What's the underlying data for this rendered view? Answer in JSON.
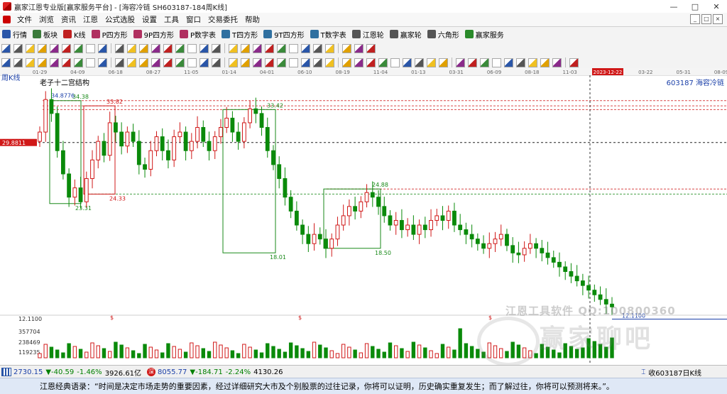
{
  "window": {
    "title": "赢家江恩专业版[赢家服务平台] - [海容冷链 SH603187-184周K线]",
    "minimize": "—",
    "maximize": "□",
    "close": "✕"
  },
  "menu": [
    "文件",
    "浏览",
    "资讯",
    "江恩",
    "公式选股",
    "设置",
    "工具",
    "窗口",
    "交易委托",
    "帮助"
  ],
  "mdi_controls": [
    "_",
    "□",
    "×"
  ],
  "toolbar1": [
    {
      "label": "行情",
      "icon": "grid-icon",
      "color": "#2a56a8"
    },
    {
      "label": "板块",
      "icon": "blocks-icon",
      "color": "#3a7a3a"
    },
    {
      "label": "K线",
      "icon": "candle-icon",
      "color": "#c02020"
    },
    {
      "label": "P四方形",
      "icon": "p-square-icon",
      "color": "#b03060"
    },
    {
      "label": "9P四方形",
      "icon": "9p-square-icon",
      "color": "#b03060"
    },
    {
      "label": "P数字表",
      "icon": "p-table-icon",
      "color": "#b03060"
    },
    {
      "label": "T四方形",
      "icon": "t-square-icon",
      "color": "#3070a0"
    },
    {
      "label": "9T四方形",
      "icon": "9t-square-icon",
      "color": "#3070a0"
    },
    {
      "label": "T数字表",
      "icon": "t-table-icon",
      "color": "#3070a0"
    },
    {
      "label": "江恩轮",
      "icon": "gann-wheel-icon",
      "color": "#555555"
    },
    {
      "label": "赢家轮",
      "icon": "winner-wheel-icon",
      "color": "#555555"
    },
    {
      "label": "六角形",
      "icon": "hexagon-icon",
      "color": "#555555"
    },
    {
      "label": "赢家服务",
      "icon": "dollar-icon",
      "color": "#2a8a2a"
    }
  ],
  "chart_labels": {
    "period": "周K线",
    "stock": "603187 海容冷链",
    "structure": "老子十二宫结构",
    "price_marker": "29.8811",
    "volume_scale": [
      "12.1100",
      "357704",
      "238469",
      "119235"
    ]
  },
  "watermark": {
    "tools": "江恩工具软件 QQ:100800360",
    "brand": "赢家聊吧"
  },
  "status": {
    "sh_index": "2730.15",
    "sh_change": "▼-40.59",
    "sh_pct": "-1.46%",
    "sh_amount": "3926.61亿",
    "sz_index": "8055.77",
    "sz_change": "▼-184.71",
    "sz_pct": "-2.24%",
    "sz_amount": "4130.26",
    "right_text": "收603187日K线"
  },
  "quote": "江恩经典语录：“时间是决定市场走势的重要因素，经过详细研究大市及个别股票的过往记录，你将可以证明，历史确实重复发生；而了解过往，你将可以预测将来。”。",
  "colors": {
    "up": "#d01818",
    "down": "#0a8a0a",
    "box_red": "#d01818",
    "box_green": "#1a8a1a",
    "guide_red": "#d01818",
    "guide_green": "#1a8a1a"
  },
  "chart_data": {
    "type": "candlestick",
    "title": "海容冷链 SH603187 周K线",
    "date_ticks": [
      "01-29",
      "04-09",
      "06-18",
      "08-27",
      "11-05",
      "01-14",
      "04-01",
      "06-10",
      "08-19",
      "11-04",
      "01-13",
      "03-31",
      "06-09",
      "08-18",
      "11-03",
      "2023-12-22",
      "03-22",
      "05-31",
      "08-09"
    ],
    "price_levels": [
      34.8776,
      34.38,
      33.82,
      33.42,
      29.8811,
      24.88,
      24.33,
      23.31,
      18.5,
      18.01,
      12.11
    ],
    "level_labels": [
      "34.8776",
      "34.38",
      "33.82",
      "33.42",
      "24.88",
      "24.33",
      "23.31",
      "18.50",
      "18.01",
      "12.1100"
    ],
    "ylim": [
      11.0,
      36.5
    ],
    "boxes": [
      {
        "label_high": "34.38",
        "label_low": "23.31",
        "high": 34.38,
        "low": 23.31,
        "color": "green"
      },
      {
        "label_high": "33.82",
        "label_low": "24.33",
        "high": 33.82,
        "low": 24.33,
        "color": "red"
      },
      {
        "label_high": "33.42",
        "label_low": "18.01",
        "high": 33.42,
        "low": 18.01,
        "color": "green"
      },
      {
        "label_high": "24.88",
        "label_low": "18.50",
        "high": 24.88,
        "low": 18.5,
        "color": "green"
      }
    ],
    "closes": [
      31,
      34.5,
      33,
      29,
      26.5,
      24,
      25,
      23.5,
      26,
      28,
      30,
      28.5,
      32,
      31,
      29.5,
      31,
      30,
      27.5,
      27,
      29,
      30.5,
      29,
      28,
      30.5,
      31,
      29,
      30,
      31.5,
      30,
      29,
      30.5,
      31.5,
      32.5,
      31,
      30,
      32,
      33.5,
      33,
      31.5,
      29,
      27.5,
      26,
      24,
      22.5,
      21,
      20,
      19,
      20,
      19.5,
      18.5,
      19.5,
      21,
      22,
      23,
      22.5,
      23.5,
      24.5,
      24,
      23,
      22,
      21,
      21.5,
      20.5,
      21,
      20,
      21,
      20.5,
      21.5,
      22,
      21.5,
      22.5,
      21,
      20.5,
      20,
      19.5,
      19,
      18.5,
      19,
      19.5,
      20,
      18.8,
      18,
      17.8,
      18.5,
      19,
      18.5,
      18,
      17.5,
      17,
      16.5,
      16,
      15.5,
      15,
      14.5,
      14,
      13.5,
      13,
      12.5,
      12.2
    ],
    "volume_scale": [
      357704,
      238469,
      119235
    ]
  }
}
